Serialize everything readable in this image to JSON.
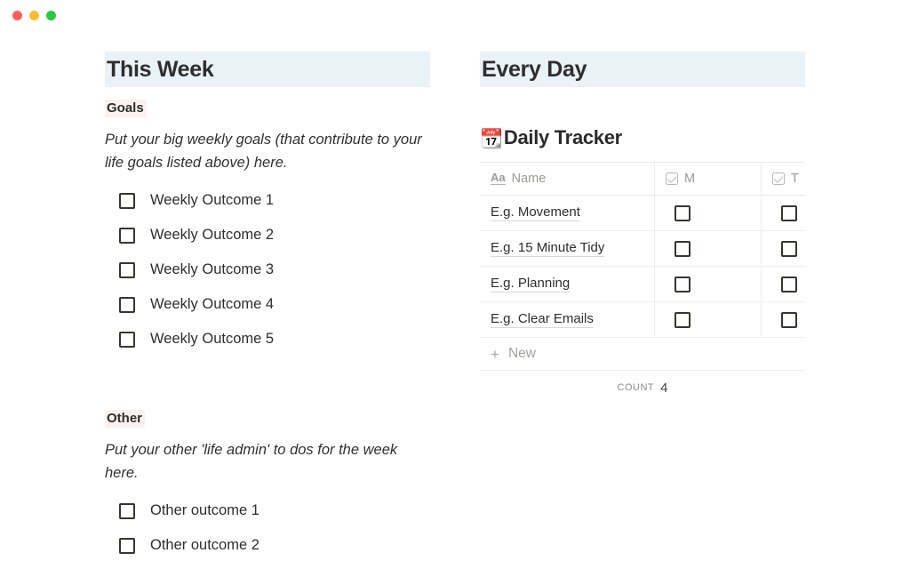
{
  "window": {
    "controls": [
      {
        "name": "close",
        "color": "#ff5f57"
      },
      {
        "name": "minimize",
        "color": "#febc2e"
      },
      {
        "name": "zoom",
        "color": "#28c840"
      }
    ]
  },
  "left_column": {
    "header": "This Week",
    "sections": [
      {
        "heading": "Goals",
        "description": "Put your big weekly goals (that contribute to your life goals listed above) here.",
        "todos": [
          {
            "label": "Weekly Outcome 1",
            "checked": false
          },
          {
            "label": "Weekly Outcome 2",
            "checked": false
          },
          {
            "label": "Weekly Outcome 3",
            "checked": false
          },
          {
            "label": "Weekly Outcome 4",
            "checked": false
          },
          {
            "label": "Weekly Outcome 5",
            "checked": false
          }
        ]
      },
      {
        "heading": "Other",
        "description": "Put your other 'life admin' to dos for the week here.",
        "todos": [
          {
            "label": "Other outcome 1",
            "checked": false
          },
          {
            "label": "Other outcome 2",
            "checked": false
          }
        ]
      }
    ]
  },
  "right_column": {
    "header": "Every Day",
    "database": {
      "emoji": "📆",
      "title": "Daily Tracker",
      "columns": [
        {
          "label": "Name",
          "icon": "text-aa-icon"
        },
        {
          "label": "M",
          "icon": "checkbox-property-icon"
        },
        {
          "label": "T",
          "icon": "checkbox-property-icon"
        }
      ],
      "rows": [
        {
          "name": "E.g. Movement",
          "m": false,
          "t": false
        },
        {
          "name": "E.g. 15 Minute Tidy",
          "m": false,
          "t": false
        },
        {
          "name": "E.g. Planning",
          "m": false,
          "t": false
        },
        {
          "name": "E.g. Clear Emails",
          "m": false,
          "t": false
        }
      ],
      "new_row_label": "New",
      "footer": {
        "label": "COUNT",
        "value": "4"
      }
    }
  },
  "colors": {
    "header_highlight": "#e8f2f7",
    "subhead_highlight": "#faf1f0",
    "text": "#2e2e2e",
    "muted": "#9b9a97"
  }
}
